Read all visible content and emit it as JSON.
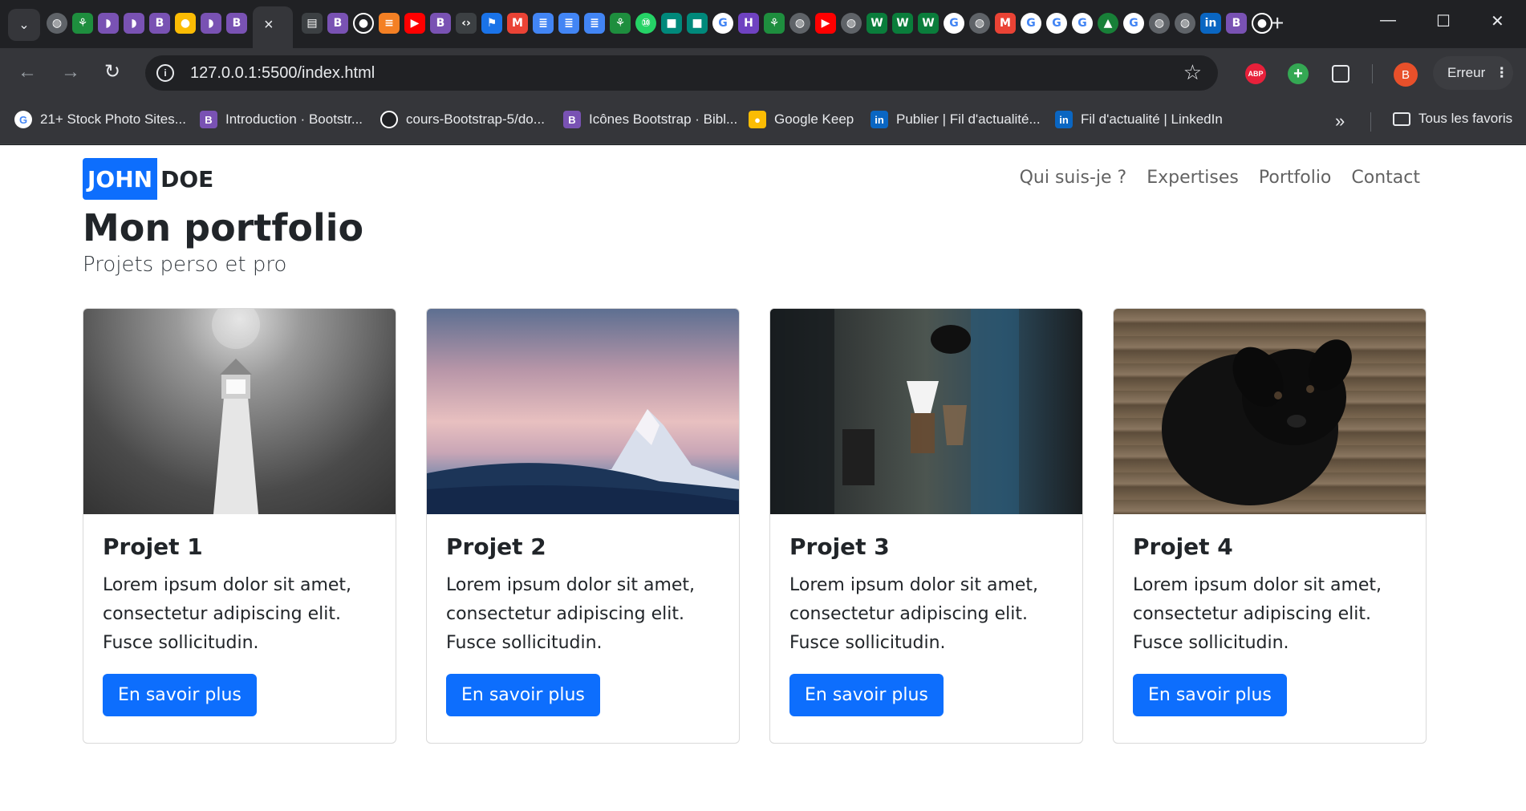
{
  "browser": {
    "url": "127.0.0.1:5500/index.html",
    "active_tab_close": "×",
    "new_tab": "+",
    "profile_initial": "B",
    "error_label": "Erreur",
    "ext_abp": "ABP",
    "bookmarks": [
      {
        "label": "21+ Stock Photo Sites...",
        "icon": "google-icon",
        "color": "#ffffff"
      },
      {
        "label": "Introduction · Bootstr...",
        "icon": "bootstrap-icon",
        "color": "#7952b3"
      },
      {
        "label": "cours-Bootstrap-5/do...",
        "icon": "github-icon",
        "color": "#ffffff"
      },
      {
        "label": "Icônes Bootstrap · Bibl...",
        "icon": "bootstrap-icon",
        "color": "#7952b3"
      },
      {
        "label": "Google Keep",
        "icon": "keep-icon",
        "color": "#fbbc04"
      },
      {
        "label": "Publier | Fil d'actualité...",
        "icon": "linkedin-icon",
        "color": "#0a66c2"
      },
      {
        "label": "Fil d'actualité | LinkedIn",
        "icon": "linkedin-icon",
        "color": "#0a66c2"
      }
    ],
    "all_bookmarks": "Tous les favoris"
  },
  "page": {
    "brand_first": "JOHN",
    "brand_last": "DOE",
    "nav": [
      "Qui suis-je ?",
      "Expertises",
      "Portfolio",
      "Contact"
    ],
    "title": "Mon portfolio",
    "subtitle": "Projets perso et pro",
    "cards": [
      {
        "title": "Projet 1",
        "text": "Lorem ipsum dolor sit amet, consectetur adipiscing elit. Fusce sollicitudin.",
        "button": "En savoir plus",
        "image": "lighthouse-photo"
      },
      {
        "title": "Projet 2",
        "text": "Lorem ipsum dolor sit amet, consectetur adipiscing elit. Fusce sollicitudin.",
        "button": "En savoir plus",
        "image": "mountain-photo"
      },
      {
        "title": "Projet 3",
        "text": "Lorem ipsum dolor sit amet, consectetur adipiscing elit. Fusce sollicitudin.",
        "button": "En savoir plus",
        "image": "coffee-photo"
      },
      {
        "title": "Projet 4",
        "text": "Lorem ipsum dolor sit amet, consectetur adipiscing elit. Fusce sollicitudin.",
        "button": "En savoir plus",
        "image": "puppy-photo"
      }
    ]
  },
  "colors": {
    "primary": "#0d6efd",
    "chrome_dark": "#202124",
    "chrome_mid": "#35363a"
  }
}
